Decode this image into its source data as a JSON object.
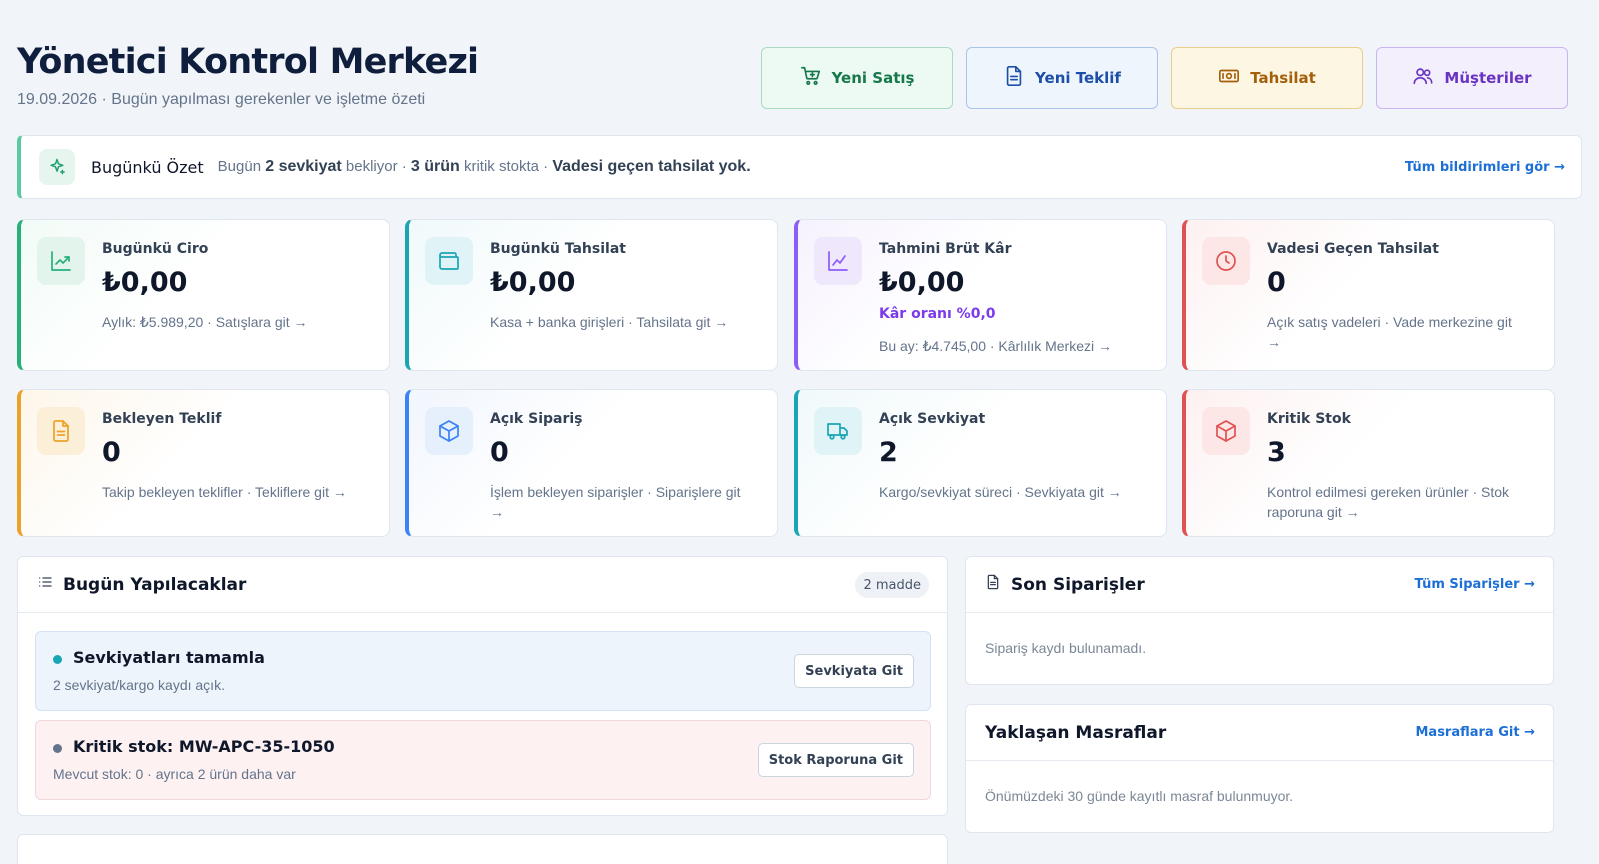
{
  "header": {
    "title": "Yönetici Kontrol Merkezi",
    "subtitle": "19.09.2026 · Bugün yapılması gerekenler ve işletme özeti"
  },
  "actions": {
    "new_sale": "Yeni Satış",
    "new_quote": "Yeni Teklif",
    "collection": "Tahsilat",
    "customers": "Müşteriler"
  },
  "summary": {
    "title": "Bugünkü Özet",
    "part1": "Bugün ",
    "strong1": "2 sevkiyat",
    "part2": " bekliyor · ",
    "strong2": "3 ürün",
    "part3": " kritik stokta · ",
    "strong3": "Vadesi geçen tahsilat yok.",
    "link": "Tüm bildirimleri gör →"
  },
  "stats": {
    "revenue": {
      "label": "Bugünkü Ciro",
      "value": "₺0,00",
      "note": "Aylık: ₺5.989,20 · Satışlara git →"
    },
    "collection": {
      "label": "Bugünkü Tahsilat",
      "value": "₺0,00",
      "note": "Kasa + banka girişleri · Tahsilata git →"
    },
    "profit": {
      "label": "Tahmini Brüt Kâr",
      "value": "₺0,00",
      "margin": "Kâr oranı %0,0",
      "note": "Bu ay: ₺4.745,00 · Kârlılık Merkezi →"
    },
    "overdue": {
      "label": "Vadesi Geçen Tahsilat",
      "value": "0",
      "note": "Açık satış vadeleri · Vade merkezine git →"
    },
    "pending_quotes": {
      "label": "Bekleyen Teklif",
      "value": "0",
      "note": "Takip bekleyen teklifler · Tekliflere git →"
    },
    "open_orders": {
      "label": "Açık Sipariş",
      "value": "0",
      "note": "İşlem bekleyen siparişler · Siparişlere git →"
    },
    "open_shipments": {
      "label": "Açık Sevkiyat",
      "value": "2",
      "note": "Kargo/sevkiyat süreci · Sevkiyata git →"
    },
    "critical_stock": {
      "label": "Kritik Stok",
      "value": "3",
      "note": "Kontrol edilmesi gereken ürünler · Stok raporuna git →"
    }
  },
  "todo": {
    "title": "Bugün Yapılacaklar",
    "badge": "2 madde",
    "items": [
      {
        "title": "Sevkiyatları tamamla",
        "sub": "2 sevkiyat/kargo kaydı açık.",
        "button": "Sevkiyata Git"
      },
      {
        "title": "Kritik stok: MW-APC-35-1050",
        "sub": "Mevcut stok: 0 · ayrıca 2 ürün daha var",
        "button": "Stok Raporuna Git"
      }
    ]
  },
  "orders": {
    "title": "Son Siparişler",
    "link": "Tüm Siparişler →",
    "empty": "Sipariş kaydı bulunamadı."
  },
  "expenses": {
    "title": "Yaklaşan Masraflar",
    "link": "Masraflara Git →",
    "empty": "Önümüzdeki 30 günde kayıtlı masraf bulunmuyor."
  }
}
